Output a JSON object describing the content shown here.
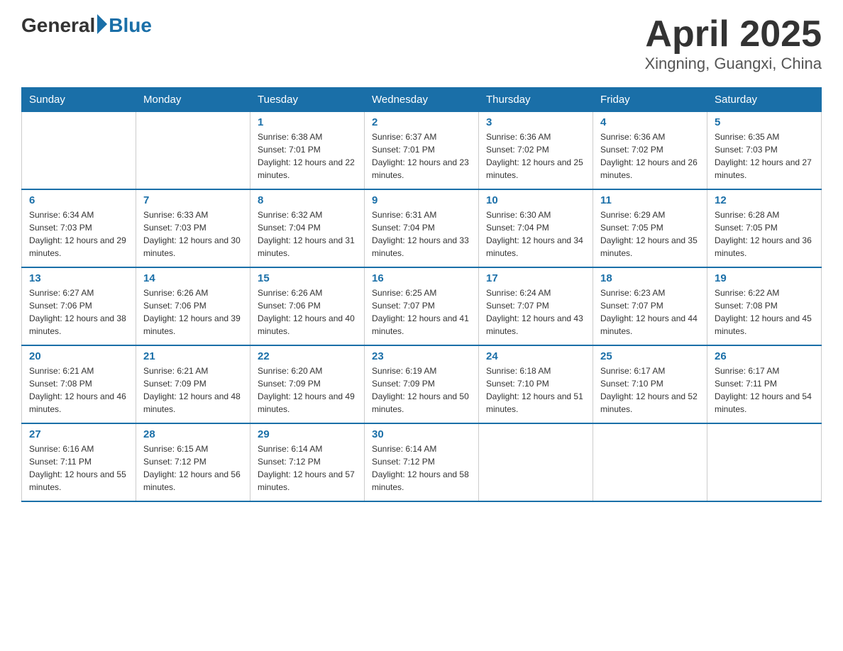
{
  "header": {
    "logo_general": "General",
    "logo_blue": "Blue",
    "title": "April 2025",
    "subtitle": "Xingning, Guangxi, China"
  },
  "weekdays": [
    "Sunday",
    "Monday",
    "Tuesday",
    "Wednesday",
    "Thursday",
    "Friday",
    "Saturday"
  ],
  "weeks": [
    [
      {
        "day": "",
        "sunrise": "",
        "sunset": "",
        "daylight": ""
      },
      {
        "day": "",
        "sunrise": "",
        "sunset": "",
        "daylight": ""
      },
      {
        "day": "1",
        "sunrise": "Sunrise: 6:38 AM",
        "sunset": "Sunset: 7:01 PM",
        "daylight": "Daylight: 12 hours and 22 minutes."
      },
      {
        "day": "2",
        "sunrise": "Sunrise: 6:37 AM",
        "sunset": "Sunset: 7:01 PM",
        "daylight": "Daylight: 12 hours and 23 minutes."
      },
      {
        "day": "3",
        "sunrise": "Sunrise: 6:36 AM",
        "sunset": "Sunset: 7:02 PM",
        "daylight": "Daylight: 12 hours and 25 minutes."
      },
      {
        "day": "4",
        "sunrise": "Sunrise: 6:36 AM",
        "sunset": "Sunset: 7:02 PM",
        "daylight": "Daylight: 12 hours and 26 minutes."
      },
      {
        "day": "5",
        "sunrise": "Sunrise: 6:35 AM",
        "sunset": "Sunset: 7:03 PM",
        "daylight": "Daylight: 12 hours and 27 minutes."
      }
    ],
    [
      {
        "day": "6",
        "sunrise": "Sunrise: 6:34 AM",
        "sunset": "Sunset: 7:03 PM",
        "daylight": "Daylight: 12 hours and 29 minutes."
      },
      {
        "day": "7",
        "sunrise": "Sunrise: 6:33 AM",
        "sunset": "Sunset: 7:03 PM",
        "daylight": "Daylight: 12 hours and 30 minutes."
      },
      {
        "day": "8",
        "sunrise": "Sunrise: 6:32 AM",
        "sunset": "Sunset: 7:04 PM",
        "daylight": "Daylight: 12 hours and 31 minutes."
      },
      {
        "day": "9",
        "sunrise": "Sunrise: 6:31 AM",
        "sunset": "Sunset: 7:04 PM",
        "daylight": "Daylight: 12 hours and 33 minutes."
      },
      {
        "day": "10",
        "sunrise": "Sunrise: 6:30 AM",
        "sunset": "Sunset: 7:04 PM",
        "daylight": "Daylight: 12 hours and 34 minutes."
      },
      {
        "day": "11",
        "sunrise": "Sunrise: 6:29 AM",
        "sunset": "Sunset: 7:05 PM",
        "daylight": "Daylight: 12 hours and 35 minutes."
      },
      {
        "day": "12",
        "sunrise": "Sunrise: 6:28 AM",
        "sunset": "Sunset: 7:05 PM",
        "daylight": "Daylight: 12 hours and 36 minutes."
      }
    ],
    [
      {
        "day": "13",
        "sunrise": "Sunrise: 6:27 AM",
        "sunset": "Sunset: 7:06 PM",
        "daylight": "Daylight: 12 hours and 38 minutes."
      },
      {
        "day": "14",
        "sunrise": "Sunrise: 6:26 AM",
        "sunset": "Sunset: 7:06 PM",
        "daylight": "Daylight: 12 hours and 39 minutes."
      },
      {
        "day": "15",
        "sunrise": "Sunrise: 6:26 AM",
        "sunset": "Sunset: 7:06 PM",
        "daylight": "Daylight: 12 hours and 40 minutes."
      },
      {
        "day": "16",
        "sunrise": "Sunrise: 6:25 AM",
        "sunset": "Sunset: 7:07 PM",
        "daylight": "Daylight: 12 hours and 41 minutes."
      },
      {
        "day": "17",
        "sunrise": "Sunrise: 6:24 AM",
        "sunset": "Sunset: 7:07 PM",
        "daylight": "Daylight: 12 hours and 43 minutes."
      },
      {
        "day": "18",
        "sunrise": "Sunrise: 6:23 AM",
        "sunset": "Sunset: 7:07 PM",
        "daylight": "Daylight: 12 hours and 44 minutes."
      },
      {
        "day": "19",
        "sunrise": "Sunrise: 6:22 AM",
        "sunset": "Sunset: 7:08 PM",
        "daylight": "Daylight: 12 hours and 45 minutes."
      }
    ],
    [
      {
        "day": "20",
        "sunrise": "Sunrise: 6:21 AM",
        "sunset": "Sunset: 7:08 PM",
        "daylight": "Daylight: 12 hours and 46 minutes."
      },
      {
        "day": "21",
        "sunrise": "Sunrise: 6:21 AM",
        "sunset": "Sunset: 7:09 PM",
        "daylight": "Daylight: 12 hours and 48 minutes."
      },
      {
        "day": "22",
        "sunrise": "Sunrise: 6:20 AM",
        "sunset": "Sunset: 7:09 PM",
        "daylight": "Daylight: 12 hours and 49 minutes."
      },
      {
        "day": "23",
        "sunrise": "Sunrise: 6:19 AM",
        "sunset": "Sunset: 7:09 PM",
        "daylight": "Daylight: 12 hours and 50 minutes."
      },
      {
        "day": "24",
        "sunrise": "Sunrise: 6:18 AM",
        "sunset": "Sunset: 7:10 PM",
        "daylight": "Daylight: 12 hours and 51 minutes."
      },
      {
        "day": "25",
        "sunrise": "Sunrise: 6:17 AM",
        "sunset": "Sunset: 7:10 PM",
        "daylight": "Daylight: 12 hours and 52 minutes."
      },
      {
        "day": "26",
        "sunrise": "Sunrise: 6:17 AM",
        "sunset": "Sunset: 7:11 PM",
        "daylight": "Daylight: 12 hours and 54 minutes."
      }
    ],
    [
      {
        "day": "27",
        "sunrise": "Sunrise: 6:16 AM",
        "sunset": "Sunset: 7:11 PM",
        "daylight": "Daylight: 12 hours and 55 minutes."
      },
      {
        "day": "28",
        "sunrise": "Sunrise: 6:15 AM",
        "sunset": "Sunset: 7:12 PM",
        "daylight": "Daylight: 12 hours and 56 minutes."
      },
      {
        "day": "29",
        "sunrise": "Sunrise: 6:14 AM",
        "sunset": "Sunset: 7:12 PM",
        "daylight": "Daylight: 12 hours and 57 minutes."
      },
      {
        "day": "30",
        "sunrise": "Sunrise: 6:14 AM",
        "sunset": "Sunset: 7:12 PM",
        "daylight": "Daylight: 12 hours and 58 minutes."
      },
      {
        "day": "",
        "sunrise": "",
        "sunset": "",
        "daylight": ""
      },
      {
        "day": "",
        "sunrise": "",
        "sunset": "",
        "daylight": ""
      },
      {
        "day": "",
        "sunrise": "",
        "sunset": "",
        "daylight": ""
      }
    ]
  ]
}
